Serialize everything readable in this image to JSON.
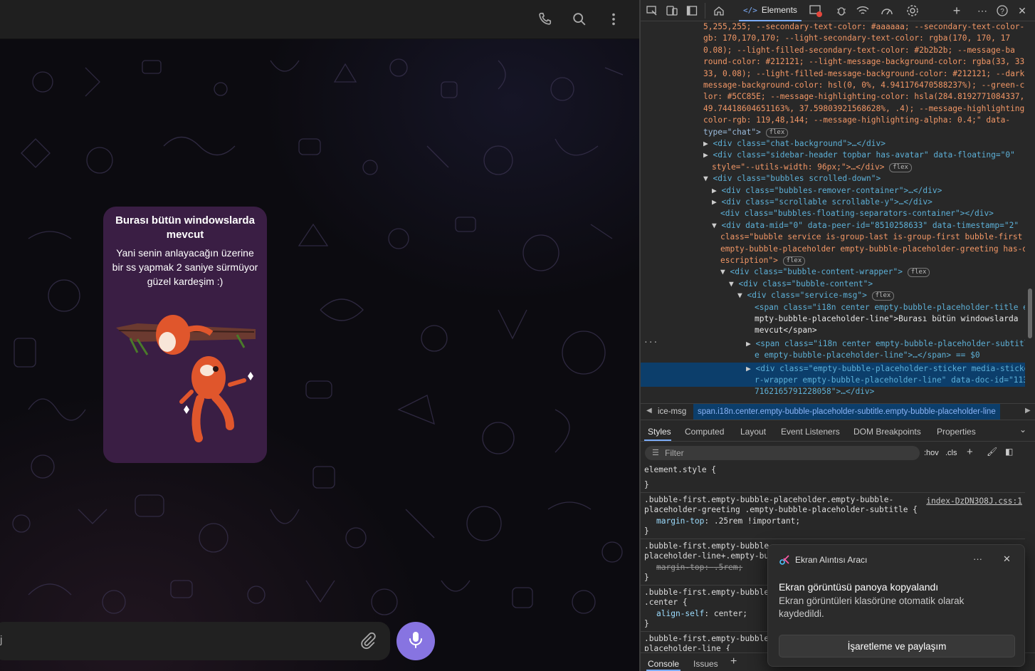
{
  "chat": {
    "header": {
      "icons": [
        "phone-icon",
        "search-icon",
        "more-vertical-icon"
      ]
    },
    "bubble": {
      "title": "Burası bütün windowslarda mevcut",
      "subtitle": "Yani senin anlayacağın üzerine bir ss yapmak 2 saniye sürmüyor güzel kardeşim :)"
    },
    "composer": {
      "text": "j"
    },
    "colors": {
      "bubble": "#3a1e44",
      "mic": "#8774e1"
    }
  },
  "devtools": {
    "toolbar": {
      "elements_tab": "Elements",
      "icons": [
        "inspect-icon",
        "device-toolbar-icon",
        "dock-icon",
        "home-icon",
        "console-error-icon",
        "bug-icon",
        "network-icon",
        "performance-icon",
        "settings-icon",
        "add-tab-icon",
        "more-icon",
        "help-icon",
        "close-icon"
      ]
    },
    "dom_lines": [
      {
        "t": "5,255,255; --secondary-text-color: #aaaaaa; --secondary-text-color-r"
      },
      {
        "t": "gb: 170,170,170; --light-secondary-text-color: rgba(170, 170, 17"
      },
      {
        "t": "0.08); --light-filled-secondary-text-color: #2b2b2b; --message-ba"
      },
      {
        "t": "round-color: #212121; --light-message-background-color: rgba(33, 33,"
      },
      {
        "t": "33, 0.08); --light-filled-message-background-color: #212121; --dark-"
      },
      {
        "t": "message-background-color: hsl(0, 0%, 4.941176470588237%); --green-co"
      },
      {
        "t": "lor: #5CC85E; --message-highlighting-color: hsla(284.8192771084337,"
      },
      {
        "t": "49.74418604651163%, 37.59803921568628%, .4); --message-highlighting-"
      },
      {
        "t": "color-rgb: 119,48,144; --message-highlighting-alpha: 0.4;\" data-"
      },
      {
        "t": "type=\"chat\">"
      },
      {
        "t": "<div class=\"chat-background\">…</div>"
      },
      {
        "t": "<div class=\"sidebar-header topbar has-avatar\" data-floating=\"0\""
      },
      {
        "t": "style=\"--utils-width: 96px;\">…</div>"
      },
      {
        "t": "<div class=\"bubbles scrolled-down\">"
      },
      {
        "t": "<div class=\"bubbles-remover-container\">…</div>"
      },
      {
        "t": "<div class=\"scrollable scrollable-y\">…</div>"
      },
      {
        "t": "<div class=\"bubbles-floating-separators-container\"></div>"
      },
      {
        "t": "<div data-mid=\"0\" data-peer-id=\"8510258633\" data-timestamp=\"2\""
      },
      {
        "t": "class=\"bubble service is-group-last is-group-first bubble-first"
      },
      {
        "t": "empty-bubble-placeholder empty-bubble-placeholder-greeting has-d"
      },
      {
        "t": "escription\">"
      },
      {
        "t": "<div class=\"bubble-content-wrapper\">"
      },
      {
        "t": "<div class=\"bubble-content\">"
      },
      {
        "t": "<div class=\"service-msg\">"
      },
      {
        "t": "<span class=\"i18n center empty-bubble-placeholder-title e"
      },
      {
        "t": "mpty-bubble-placeholder-line\">Burası bütün windowslarda"
      },
      {
        "t": "mevcut</span>"
      },
      {
        "t": "<span class=\"i18n center empty-bubble-placeholder-subtitl"
      },
      {
        "t": "e empty-bubble-placeholder-line\">…</span> == $0"
      },
      {
        "t": "<div class=\"empty-bubble-placeholder-sticker media-sticke"
      },
      {
        "t": "r-wrapper empty-bubble-placeholder-line\" data-doc-id=\"113"
      },
      {
        "t": "7162165791228058\">…</div>"
      }
    ],
    "breadcrumbs": [
      "ice-msg",
      "span.i18n.center.empty-bubble-placeholder-subtitle.empty-bubble-placeholder-line"
    ],
    "panel_tabs": [
      "Styles",
      "Computed",
      "Layout",
      "Event Listeners",
      "DOM Breakpoints",
      "Properties"
    ],
    "filter": {
      "placeholder": "Filter",
      "hov": ":hov",
      "cls": ".cls"
    },
    "styles": {
      "element_style": "element.style {",
      "close": "}",
      "rule1_sel_1": ".bubble-first.empty-bubble-placeholder.empty-bubble-",
      "rule1_sel_2": "placeholder-greeting .empty-bubble-placeholder-subtitle {",
      "rule1_src": "index-DzDN3O8J.css:1",
      "rule1_prop": "margin-top",
      "rule1_val": ".25rem !important;",
      "rule2_sel_1": ".bubble-first.empty-bubble-",
      "rule2_sel_2": "placeholder-line+.empty-bub",
      "rule2_prop": "margin-top",
      "rule2_val": ".5rem;",
      "rule3_sel_1": ".bubble-first.empty-bubble-",
      "rule3_sel_2": ".center {",
      "rule3_prop": "align-self",
      "rule3_val": "center;",
      "rule4_sel_1": ".bubble-first.empty-bubble-",
      "rule4_sel_2": "placeholder-line {"
    },
    "drawer_tabs": [
      "Console",
      "Issues"
    ]
  },
  "toast": {
    "app_name": "Ekran Alıntısı Aracı",
    "title": "Ekran görüntüsü panoya kopyalandı",
    "body": "Ekran görüntüleri klasörüne otomatik olarak kaydedildi.",
    "button": "İşaretleme ve paylaşım",
    "more": "···",
    "close": "✕"
  }
}
